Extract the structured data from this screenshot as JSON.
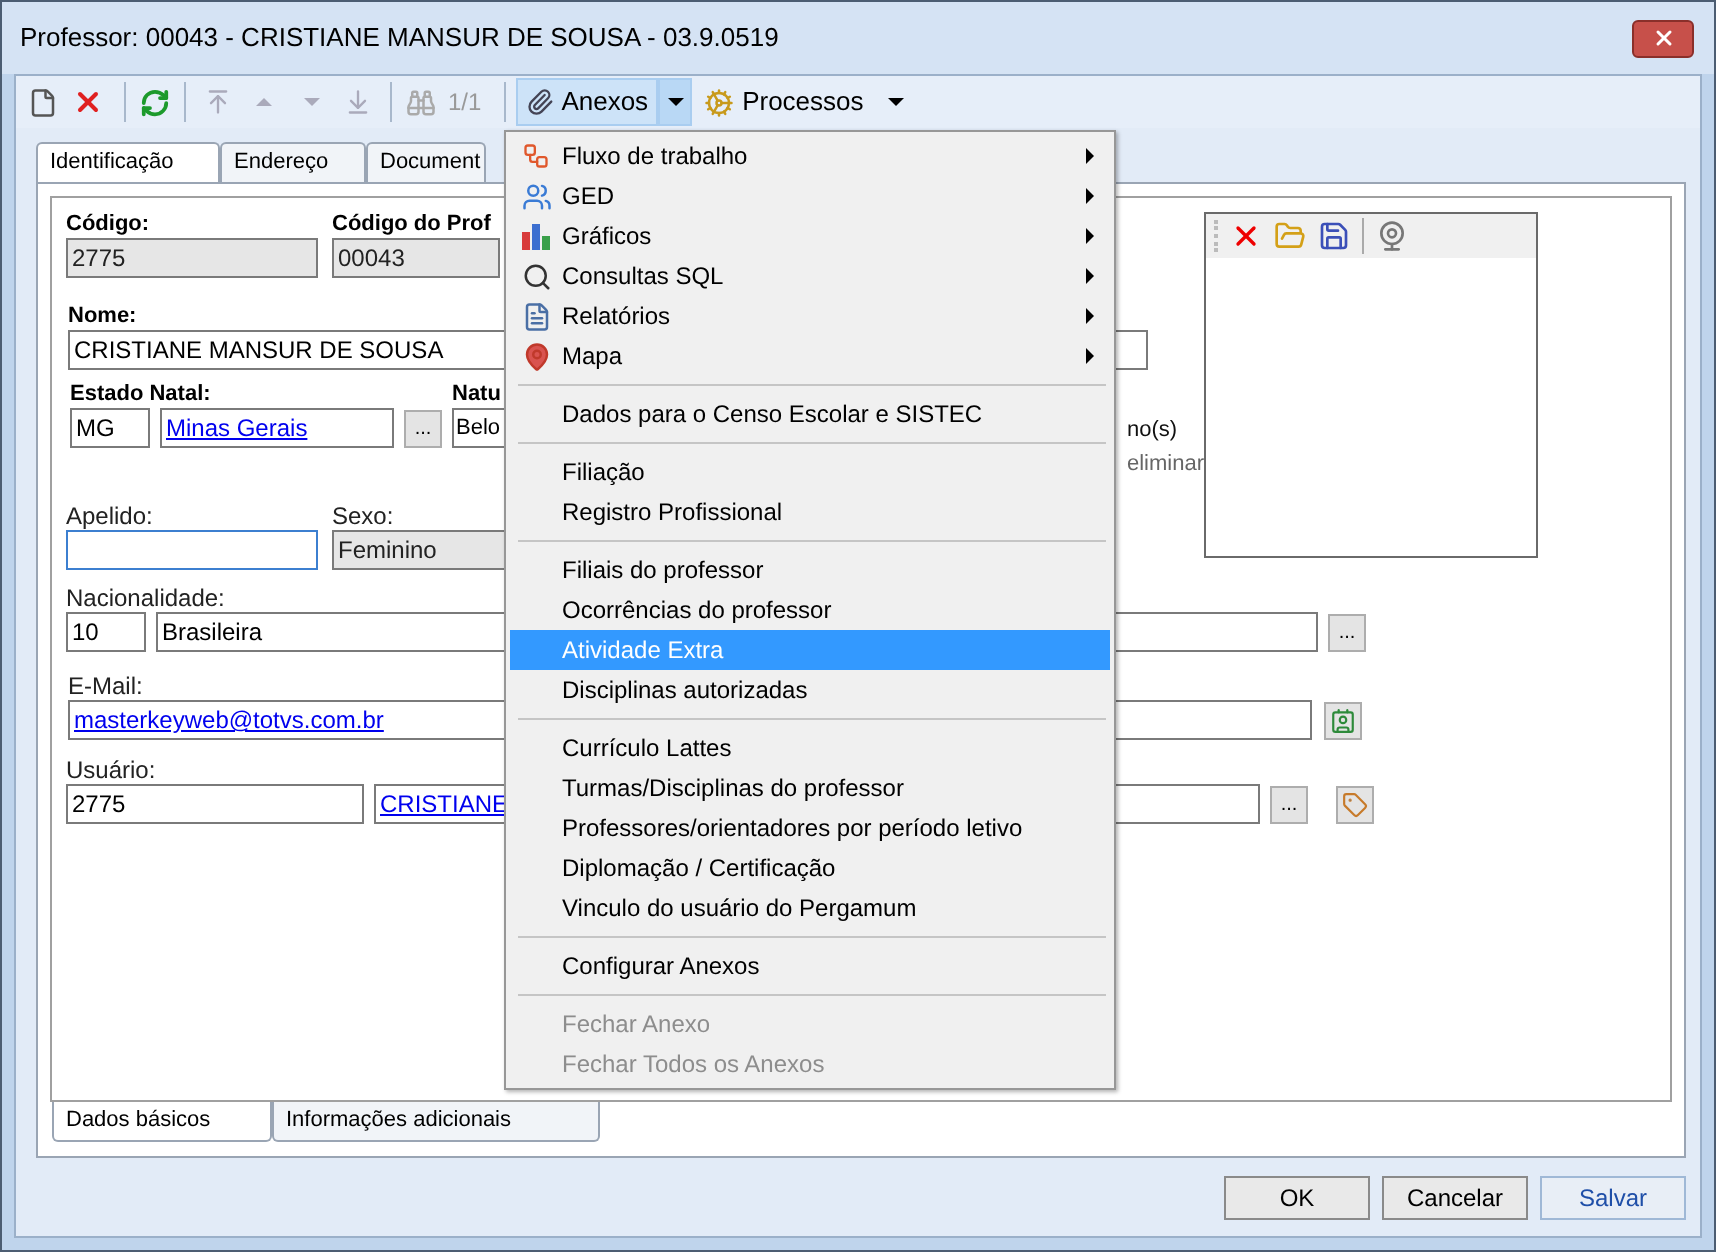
{
  "window": {
    "title": "Professor: 00043 - CRISTIANE MANSUR DE SOUSA - 03.9.0519"
  },
  "toolbar": {
    "record_position": "1/1",
    "attachments_button": {
      "label": "Anexos",
      "open": true
    },
    "processes_button": {
      "label": "Processos"
    }
  },
  "tabs": [
    {
      "label": "Identificação",
      "selected": true
    },
    {
      "label": "Endereço",
      "selected": false
    },
    {
      "label": "Document",
      "selected": false
    }
  ],
  "form": {
    "code": {
      "label": "Código:",
      "value": "2775"
    },
    "professor_code": {
      "label": "Código do Prof",
      "value": "00043"
    },
    "name": {
      "label": "Nome:",
      "value": "CRISTIANE MANSUR DE SOUSA"
    },
    "birth_state": {
      "label": "Estado Natal:",
      "code": "MG",
      "name": "Minas Gerais",
      "button": "..."
    },
    "birthplace": {
      "label": "Natu",
      "value": "Belo"
    },
    "partial_texts": [
      "no(s)",
      "eliminar"
    ],
    "nickname": {
      "label": "Apelido:",
      "focused": true
    },
    "sex": {
      "label": "Sexo:",
      "value": "Feminino"
    },
    "nationality": {
      "label": "Nacionalidade:",
      "code": "10",
      "name": "Brasileira",
      "button": "..."
    },
    "email": {
      "label": "E-Mail:",
      "value": "masterkeyweb@totvs.com.br"
    },
    "user": {
      "label": "Usuário:",
      "code": "2775",
      "name": "CRISTIANE",
      "button": "..."
    }
  },
  "menu": {
    "groups": [
      [
        {
          "label": "Fluxo de trabalho",
          "submenu": true,
          "selected": false,
          "disabled": false
        },
        {
          "label": "GED",
          "submenu": true,
          "selected": false,
          "disabled": false
        },
        {
          "label": "Gráficos",
          "submenu": true,
          "selected": false,
          "disabled": false
        },
        {
          "label": "Consultas SQL",
          "submenu": true,
          "selected": false,
          "disabled": false
        },
        {
          "label": "Relatórios",
          "submenu": true,
          "selected": false,
          "disabled": false
        },
        {
          "label": "Mapa",
          "submenu": true,
          "selected": false,
          "disabled": false
        }
      ],
      [
        {
          "label": "Dados para o Censo Escolar e SISTEC",
          "submenu": false,
          "selected": false,
          "disabled": false
        }
      ],
      [
        {
          "label": "Filiação",
          "submenu": false,
          "selected": false,
          "disabled": false
        },
        {
          "label": "Registro Profissional",
          "submenu": false,
          "selected": false,
          "disabled": false
        }
      ],
      [
        {
          "label": "Filiais do professor",
          "submenu": false,
          "selected": false,
          "disabled": false
        },
        {
          "label": "Ocorrências do professor",
          "submenu": false,
          "selected": false,
          "disabled": false
        },
        {
          "label": "Atividade Extra",
          "submenu": false,
          "selected": true,
          "disabled": false
        },
        {
          "label": "Disciplinas autorizadas",
          "submenu": false,
          "selected": false,
          "disabled": false
        }
      ],
      [
        {
          "label": "Currículo Lattes",
          "submenu": false,
          "selected": false,
          "disabled": false
        },
        {
          "label": "Turmas/Disciplinas do professor",
          "submenu": false,
          "selected": false,
          "disabled": false
        },
        {
          "label": "Professores/orientadores por período letivo",
          "submenu": false,
          "selected": false,
          "disabled": false
        },
        {
          "label": "Diplomação / Certificação",
          "submenu": false,
          "selected": false,
          "disabled": false
        },
        {
          "label": "Vinculo do usuário do Pergamum",
          "submenu": false,
          "selected": false,
          "disabled": false
        }
      ],
      [
        {
          "label": "Configurar Anexos",
          "submenu": false,
          "selected": false,
          "disabled": false
        }
      ],
      [
        {
          "label": "Fechar Anexo",
          "submenu": false,
          "selected": false,
          "disabled": true
        },
        {
          "label": "Fechar Todos os Anexos",
          "submenu": false,
          "selected": false,
          "disabled": true
        }
      ]
    ]
  },
  "bottom_tabs": [
    {
      "label": "Dados básicos",
      "selected": true
    },
    {
      "label": "Informações adicionais",
      "selected": false
    }
  ],
  "buttons": [
    {
      "label": "OK",
      "focused": false
    },
    {
      "label": "Cancelar",
      "focused": false
    },
    {
      "label": "Salvar",
      "focused": true
    }
  ]
}
